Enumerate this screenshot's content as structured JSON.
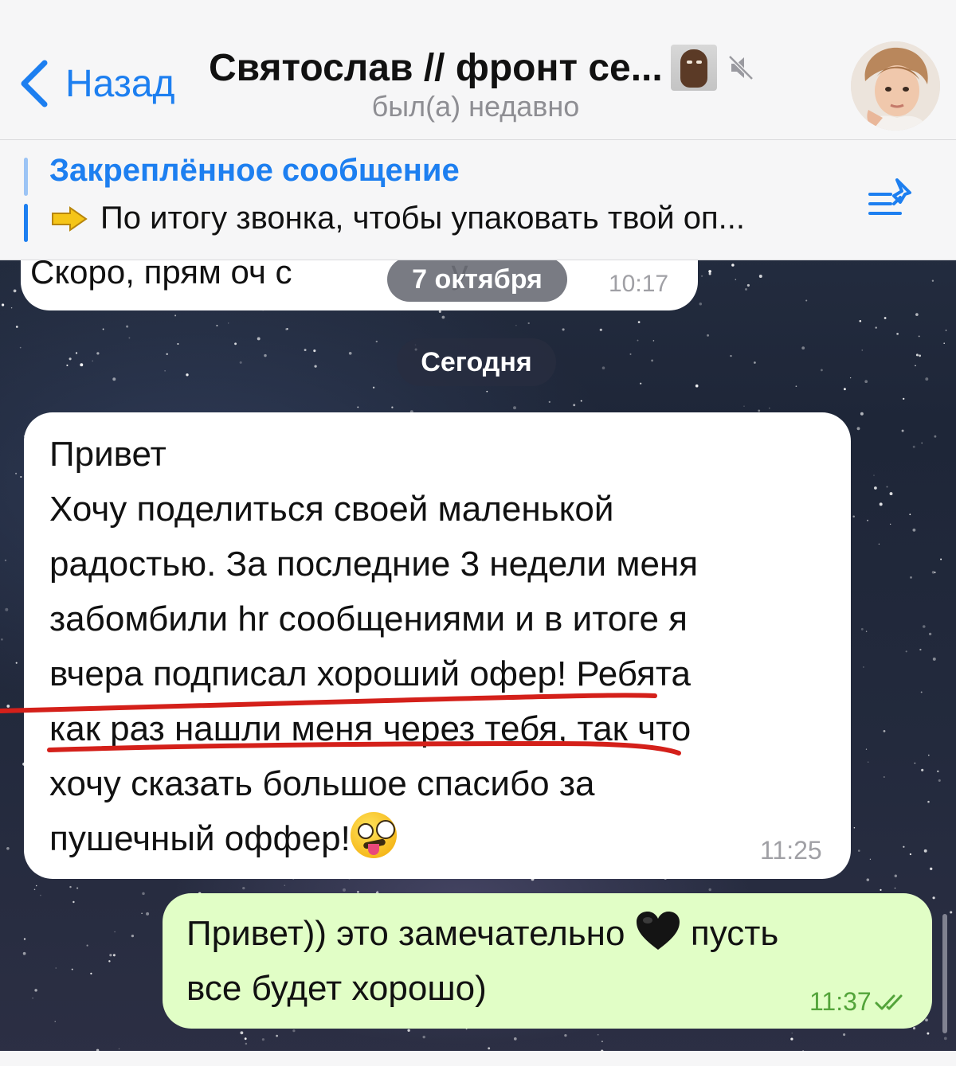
{
  "header": {
    "back_label": "Назад",
    "chat_title": "Святослав // фронт се...",
    "status": "был(а) недавно"
  },
  "pinned": {
    "title": "Закреплённое сообщение",
    "text": "По итогу звонка, чтобы упаковать твой оп..."
  },
  "previous_message": {
    "text_start": "Скоро, прям оч с",
    "text_end": "у",
    "time": "10:17"
  },
  "date_separators": [
    "7 октября",
    "Сегодня"
  ],
  "incoming_message": {
    "lines": [
      "Привет",
      "Хочу поделиться своей маленькой",
      "радостью. За последние 3 недели меня",
      "забомбили hr сообщениями и в итоге я",
      "вчера подписал хороший офер! Ребята",
      "как раз нашли меня через тебя, так что",
      "хочу сказать большое спасибо за",
      "пушечный оффер!"
    ],
    "emoji": "zany-face",
    "time": "11:25"
  },
  "outgoing_message": {
    "line1_start": "Привет)) это замечательно",
    "line1_end": "пусть",
    "line2": "все будет хорошо)",
    "emoji": "black-heart",
    "time": "11:37",
    "status": "read"
  },
  "colors": {
    "accent": "#1d7ff0",
    "outgoing_bubble": "#e1fec6",
    "highlight_underline": "#d4201a"
  }
}
